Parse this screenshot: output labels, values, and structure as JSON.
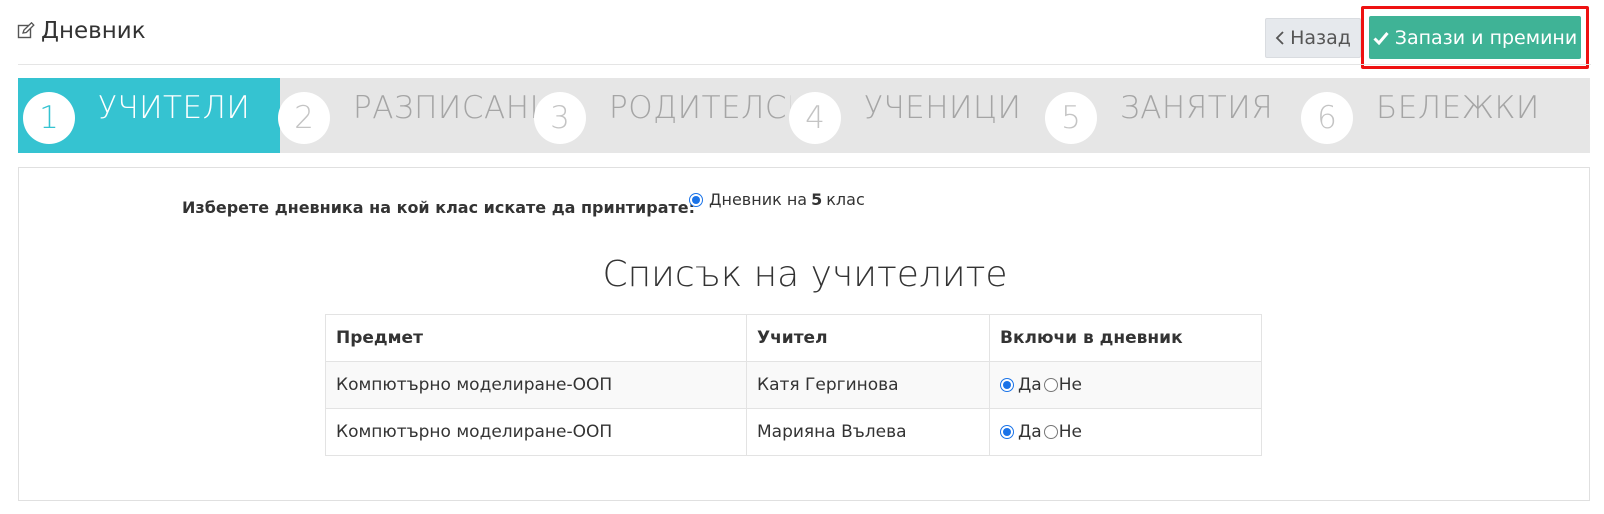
{
  "header": {
    "title": "Дневник",
    "back_label": "Назад",
    "save_label": "Запази и премини"
  },
  "wizard": {
    "steps": [
      {
        "number": "1",
        "label": "УЧИТЕЛИ",
        "active": true
      },
      {
        "number": "2",
        "label": "РАЗПИСАНИЕ",
        "active": false
      },
      {
        "number": "3",
        "label": "РОДИТЕЛСКИ",
        "active": false
      },
      {
        "number": "4",
        "label": "УЧЕНИЦИ",
        "active": false
      },
      {
        "number": "5",
        "label": "ЗАНЯТИЯ",
        "active": false
      },
      {
        "number": "6",
        "label": "БЕЛЕЖКИ",
        "active": false
      }
    ]
  },
  "class_select": {
    "label": "Изберете дневника на кой клас искате да принтирате:",
    "option_prefix": "Дневник на",
    "option_class": "5",
    "option_suffix": "клас"
  },
  "teachers": {
    "title": "Списък на учителите",
    "columns": [
      "Предмет",
      "Учител",
      "Включи в дневник"
    ],
    "rows": [
      {
        "subject": "Компютърно моделиране-ООП",
        "teacher": "Катя Гергинова",
        "include": "yes"
      },
      {
        "subject": "Компютърно моделиране-ООП",
        "teacher": "Марияна Вълева",
        "include": "yes"
      }
    ],
    "yes_label": "Да",
    "no_label": "Не"
  },
  "colors": {
    "active_step": "#35c3d1",
    "save_button": "#3fb396",
    "highlight": "#ee1111"
  }
}
